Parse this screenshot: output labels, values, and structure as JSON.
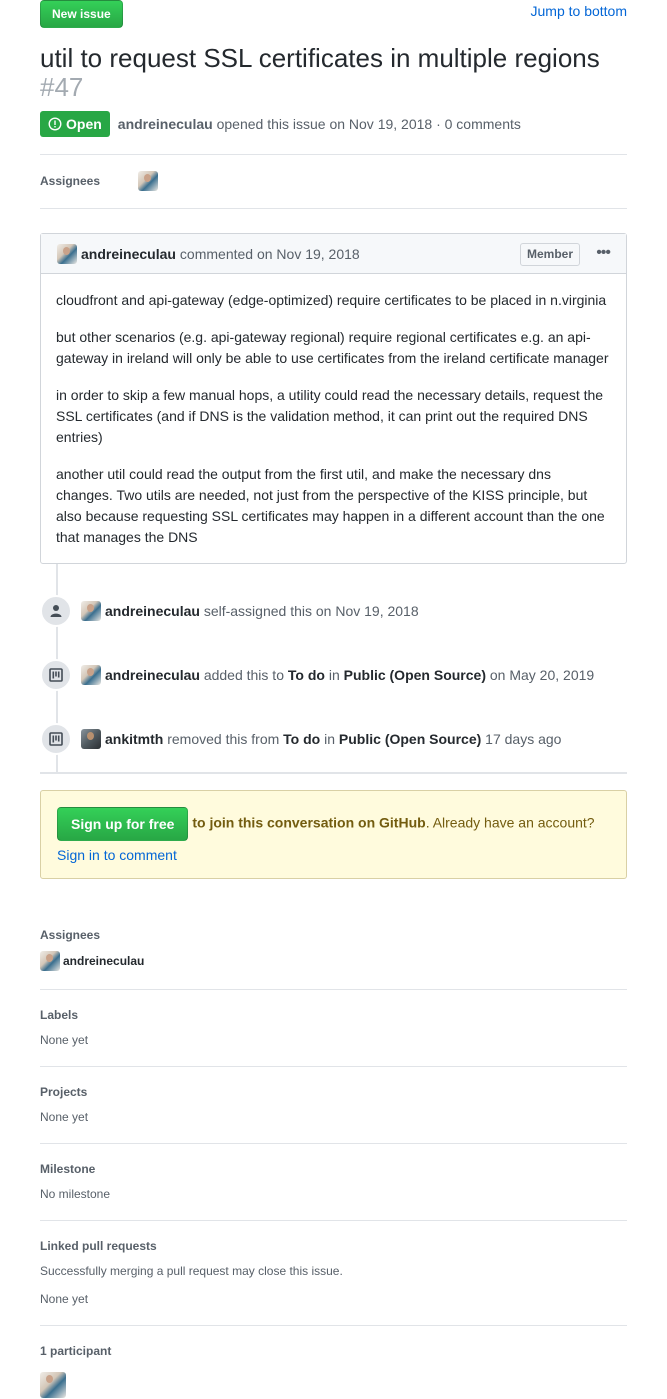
{
  "header": {
    "new_issue_label": "New issue",
    "jump_label": "Jump to bottom",
    "title": "util to request SSL certificates in multiple regions",
    "number": "#47"
  },
  "meta": {
    "state": "Open",
    "author": "andreineculau",
    "opened_text": "opened this issue on Nov 19, 2018 · 0 comments"
  },
  "assignees_top": {
    "label": "Assignees"
  },
  "comment": {
    "author": "andreineculau",
    "verb": "commented on Nov 19, 2018",
    "badge": "Member",
    "paragraphs": [
      "cloudfront and api-gateway (edge-optimized) require certificates to be placed in n.virginia",
      "but other scenarios (e.g. api-gateway regional) require regional certificates e.g. an api-gateway in ireland will only be able to use certificates from the ireland certificate manager",
      "in order to skip a few manual hops, a utility could read the necessary details, request the SSL certificates (and if DNS is the validation method, it can print out the required DNS entries)",
      "another util could read the output from the first util, and make the necessary dns changes. Two utils are needed, not just from the perspective of the KISS principle, but also because requesting SSL certificates may happen in a different account than the one that manages the DNS"
    ]
  },
  "events": [
    {
      "actor": "andreineculau",
      "text1": "self-assigned this on Nov 19, 2018"
    },
    {
      "actor": "andreineculau",
      "text1": "added this to",
      "column": "To do",
      "in": "in",
      "project": "Public (Open Source)",
      "when": "on May 20, 2019"
    },
    {
      "actor": "ankitmth",
      "text1": "removed this from",
      "column": "To do",
      "in": "in",
      "project": "Public (Open Source)",
      "when": "17 days ago"
    }
  ],
  "signup": {
    "button": "Sign up for free",
    "bold_text": "to join this conversation on GitHub",
    "rest": ". Already have an account? ",
    "link": "Sign in to comment"
  },
  "sidebar": {
    "assignees_label": "Assignees",
    "assignee_name": "andreineculau",
    "labels_label": "Labels",
    "labels_value": "None yet",
    "projects_label": "Projects",
    "projects_value": "None yet",
    "milestone_label": "Milestone",
    "milestone_value": "No milestone",
    "linked_label": "Linked pull requests",
    "linked_note": "Successfully merging a pull request may close this issue.",
    "linked_value": "None yet",
    "participants_label": "1 participant"
  },
  "colors": {
    "green": "#28a745",
    "link": "#0366d6",
    "muted": "#586069"
  }
}
